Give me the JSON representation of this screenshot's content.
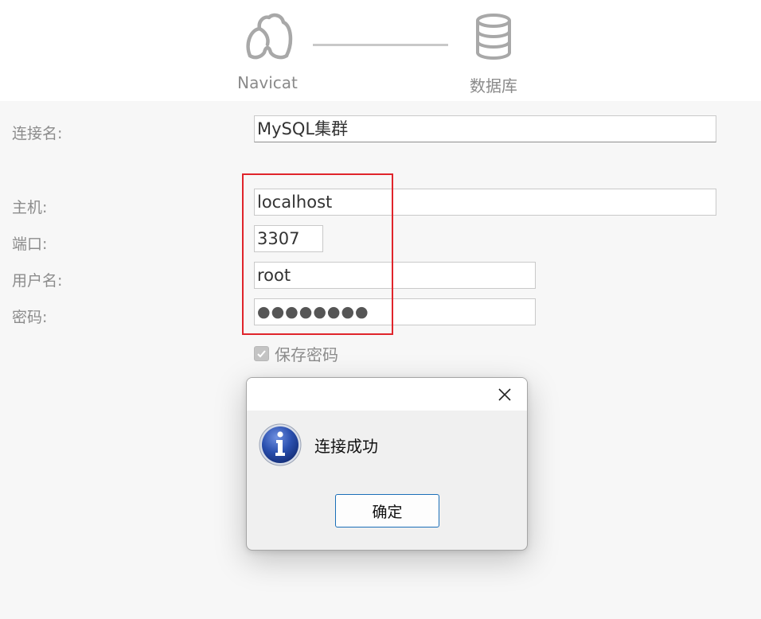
{
  "wizard": {
    "steps": [
      {
        "label": "Navicat",
        "icon": "navicat-icon"
      },
      {
        "label": "数据库",
        "icon": "database-icon"
      }
    ]
  },
  "form": {
    "connection_name": {
      "label": "连接名:",
      "value": "MySQL集群"
    },
    "host": {
      "label": "主机:",
      "value": "localhost"
    },
    "port": {
      "label": "端口:",
      "value": "3307"
    },
    "username": {
      "label": "用户名:",
      "value": "root"
    },
    "password": {
      "label": "密码:",
      "value": "●●●●●●●●"
    },
    "save_password": {
      "label": "保存密码",
      "checked": true
    }
  },
  "dialog": {
    "message": "连接成功",
    "ok_label": "确定",
    "icon": "info-icon"
  },
  "colors": {
    "highlight": "#e0242b",
    "dialog_button_border": "#1b6fb8",
    "info_icon": "#2a4fae"
  }
}
